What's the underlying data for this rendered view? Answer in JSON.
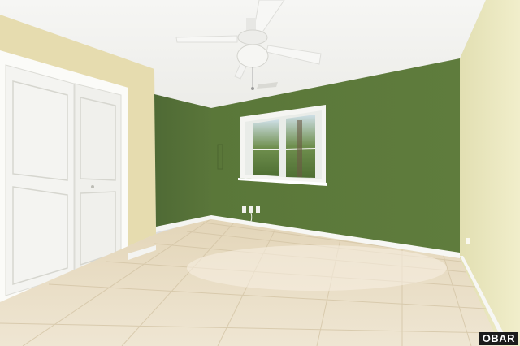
{
  "photo": {
    "watermark": "OBAR"
  },
  "colors": {
    "ceiling": "#f4f4f2",
    "left_wall": "#e6dcae",
    "back_wall_green": "#5e7a3c",
    "left_green_wall": "#57733a",
    "right_wall": "#ece9c0",
    "floor": "#e8dcc4",
    "trim": "#ffffff"
  }
}
